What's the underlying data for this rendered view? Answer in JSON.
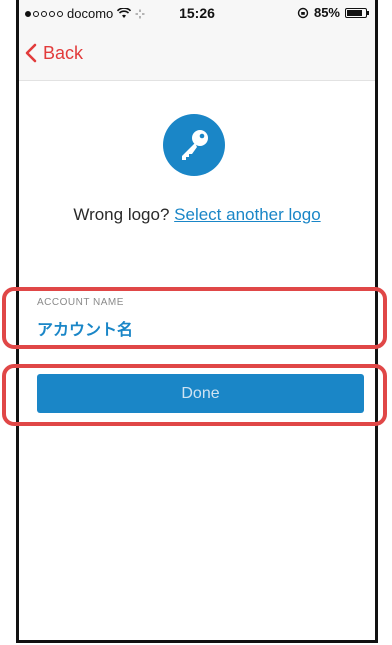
{
  "status_bar": {
    "carrier": "docomo",
    "time": "15:26",
    "battery_percent": "85%",
    "battery_level": 0.85,
    "signal_bars_on": 1,
    "signal_bars_total": 5
  },
  "nav": {
    "back_label": "Back"
  },
  "logo": {
    "icon": "key-icon",
    "wrong_logo_text": "Wrong logo?",
    "select_another_link": "Select another logo"
  },
  "account_field": {
    "label": "ACCOUNT NAME",
    "value": "アカウント名"
  },
  "done_button": {
    "label": "Done"
  },
  "colors": {
    "accent_blue": "#1a86c7",
    "back_red": "#e23b3b",
    "highlight_red": "#e04747"
  }
}
